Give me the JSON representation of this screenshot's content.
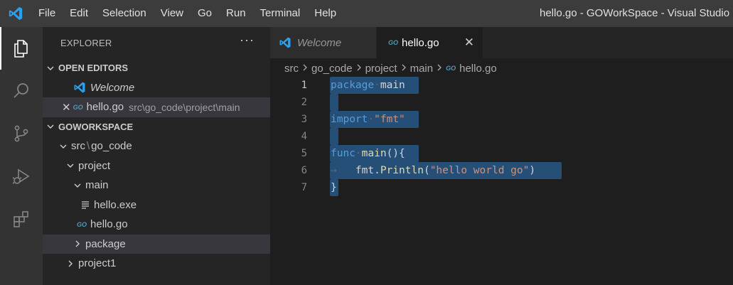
{
  "window": {
    "title": "hello.go - GOWorkSpace - Visual Studio C",
    "menu": [
      "File",
      "Edit",
      "Selection",
      "View",
      "Go",
      "Run",
      "Terminal",
      "Help"
    ]
  },
  "activitybar": [
    "explorer-icon",
    "search-icon",
    "source-control-icon",
    "run-debug-icon",
    "extensions-icon"
  ],
  "sidebar": {
    "header": "EXPLORER",
    "more": "···",
    "open_editors_label": "OPEN EDITORS",
    "open_editors": [
      {
        "name": "Welcome"
      },
      {
        "name": "hello.go",
        "path": "src\\go_code\\project\\main",
        "badge": "GO"
      }
    ],
    "workspace_label": "GOWORKSPACE",
    "tree": {
      "src": "src",
      "sep": "\\",
      "go_code": "go_code",
      "project": "project",
      "main": "main",
      "hello_exe": "hello.exe",
      "hello_go": "hello.go",
      "package": "package",
      "project1": "project1"
    }
  },
  "tabs": [
    {
      "label": "Welcome",
      "active": false
    },
    {
      "label": "hello.go",
      "active": true,
      "badge": "GO",
      "close": "✕"
    }
  ],
  "breadcrumb": [
    "src",
    "go_code",
    "project",
    "main",
    "hello.go"
  ],
  "code": {
    "line_numbers": [
      "1",
      "2",
      "3",
      "4",
      "5",
      "6",
      "7"
    ],
    "l1_kw": "package",
    "l1_name": "main",
    "l3_kw": "import",
    "l3_str": "\"fmt\"",
    "l5_kw": "func",
    "l5_fn": "main",
    "l5_rest": "(){",
    "l6_obj": "fmt.",
    "l6_fn": "Println",
    "l6_open": "(",
    "l6_str": "\"hello world go\"",
    "l6_close": ")",
    "l7": "}"
  },
  "colors": {
    "accent": "#007acc",
    "selection": "#264f78",
    "keyword": "#569cd6",
    "string": "#ce9178",
    "function": "#dcdcaa"
  }
}
